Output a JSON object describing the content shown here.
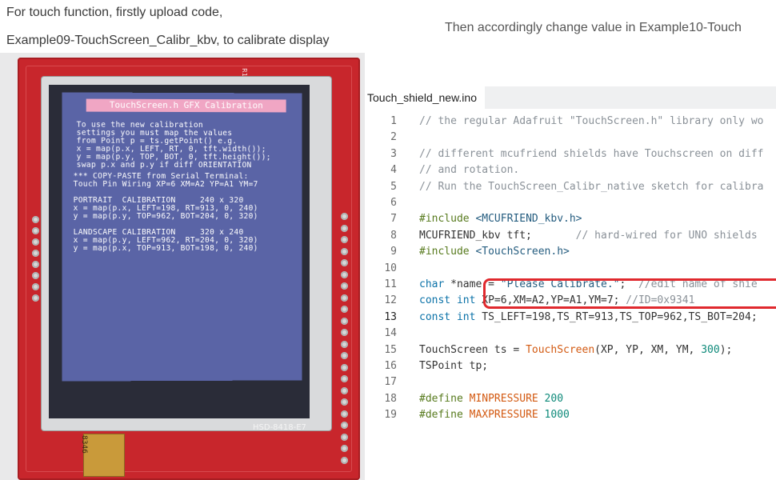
{
  "captions": {
    "left_line1": "For touch function, firstly upload code,",
    "left_line2": "Example09-TouchScreen_Calibr_kbv, to calibrate display",
    "right": "Then accordingly change value in Example10-Touch"
  },
  "photo": {
    "screen_title": "TouchScreen.h GFX Calibration",
    "screen_block1": "To use the new calibration\nsettings you must map the values\nfrom Point p = ts.getPoint() e.g.\nx = map(p.x, LEFT, RT, 0, tft.width());\ny = map(p.y, TOP, BOT, 0, tft.height());\nswap p.x and p.y if diff ORIENTATION",
    "screen_block2": "*** COPY-PASTE from Serial Terminal:\nTouch Pin Wiring XP=6 XM=A2 YP=A1 YM=7\n\nPORTRAIT  CALIBRATION     240 x 320\nx = map(p.x, LEFT=198, RT=913, 0, 240)\ny = map(p.y, TOP=962, BOT=204, 0, 320)\n\nLANDSCAPE CALIBRATION     320 x 240\nx = map(p.y, LEFT=962, RT=204, 0, 320)\ny = map(p.x, TOP=913, BOT=198, 0, 240)",
    "board_label": "HSD-8418-E7",
    "r1_label": "R1",
    "ribbon_label": "8346"
  },
  "editor": {
    "tab_label": "Touch_shield_new.ino",
    "active_line": 13,
    "highlight_color": "#e0292e",
    "lines": [
      {
        "n": "1",
        "tokens": [
          {
            "t": "// the regular Adafruit \"TouchScreen.h\" library only wo",
            "c": "cm"
          }
        ]
      },
      {
        "n": "2",
        "tokens": []
      },
      {
        "n": "3",
        "tokens": [
          {
            "t": "// different mcufriend shields have Touchscreen on diff",
            "c": "cm"
          }
        ]
      },
      {
        "n": "4",
        "tokens": [
          {
            "t": "// and rotation.",
            "c": "cm"
          }
        ]
      },
      {
        "n": "5",
        "tokens": [
          {
            "t": "// Run the TouchScreen_Calibr_native sketch for calibra",
            "c": "cm"
          }
        ]
      },
      {
        "n": "6",
        "tokens": []
      },
      {
        "n": "7",
        "tokens": [
          {
            "t": "#include ",
            "c": "pp"
          },
          {
            "t": "<MCUFRIEND_kbv.h>",
            "c": "str"
          }
        ]
      },
      {
        "n": "8",
        "tokens": [
          {
            "t": "MCUFRIEND_kbv tft;       ",
            "c": "plain"
          },
          {
            "t": "// hard-wired for UNO shields",
            "c": "cm"
          }
        ]
      },
      {
        "n": "9",
        "tokens": [
          {
            "t": "#include ",
            "c": "pp"
          },
          {
            "t": "<TouchScreen.h>",
            "c": "str"
          }
        ]
      },
      {
        "n": "10",
        "tokens": []
      },
      {
        "n": "11",
        "tokens": [
          {
            "t": "char",
            "c": "kw"
          },
          {
            "t": " *name = ",
            "c": "plain"
          },
          {
            "t": "\"Please Calibrate.\"",
            "c": "str"
          },
          {
            "t": ";  ",
            "c": "plain"
          },
          {
            "t": "//edit name of shie",
            "c": "cm"
          }
        ]
      },
      {
        "n": "12",
        "tokens": [
          {
            "t": "const int",
            "c": "kw"
          },
          {
            "t": " XP=6,XM=A2,YP=A1,YM=7; ",
            "c": "plain"
          },
          {
            "t": "//ID=0x9341",
            "c": "cm"
          }
        ]
      },
      {
        "n": "13",
        "tokens": [
          {
            "t": "const int",
            "c": "kw"
          },
          {
            "t": " TS_LEFT=198,TS_RT=913,TS_TOP=962,TS_BOT=204;",
            "c": "plain"
          }
        ]
      },
      {
        "n": "14",
        "tokens": []
      },
      {
        "n": "15",
        "tokens": [
          {
            "t": "TouchScreen ts = ",
            "c": "plain"
          },
          {
            "t": "TouchScreen",
            "c": "fn"
          },
          {
            "t": "(XP, YP, XM, YM, ",
            "c": "plain"
          },
          {
            "t": "300",
            "c": "num"
          },
          {
            "t": ");",
            "c": "plain"
          }
        ]
      },
      {
        "n": "16",
        "tokens": [
          {
            "t": "TSPoint tp;",
            "c": "plain"
          }
        ]
      },
      {
        "n": "17",
        "tokens": []
      },
      {
        "n": "18",
        "tokens": [
          {
            "t": "#define ",
            "c": "pp"
          },
          {
            "t": "MINPRESSURE",
            "c": "fn"
          },
          {
            "t": " ",
            "c": "plain"
          },
          {
            "t": "200",
            "c": "num"
          }
        ]
      },
      {
        "n": "19",
        "tokens": [
          {
            "t": "#define ",
            "c": "pp"
          },
          {
            "t": "MAXPRESSURE",
            "c": "fn"
          },
          {
            "t": " ",
            "c": "plain"
          },
          {
            "t": "1000",
            "c": "num"
          }
        ]
      }
    ]
  }
}
